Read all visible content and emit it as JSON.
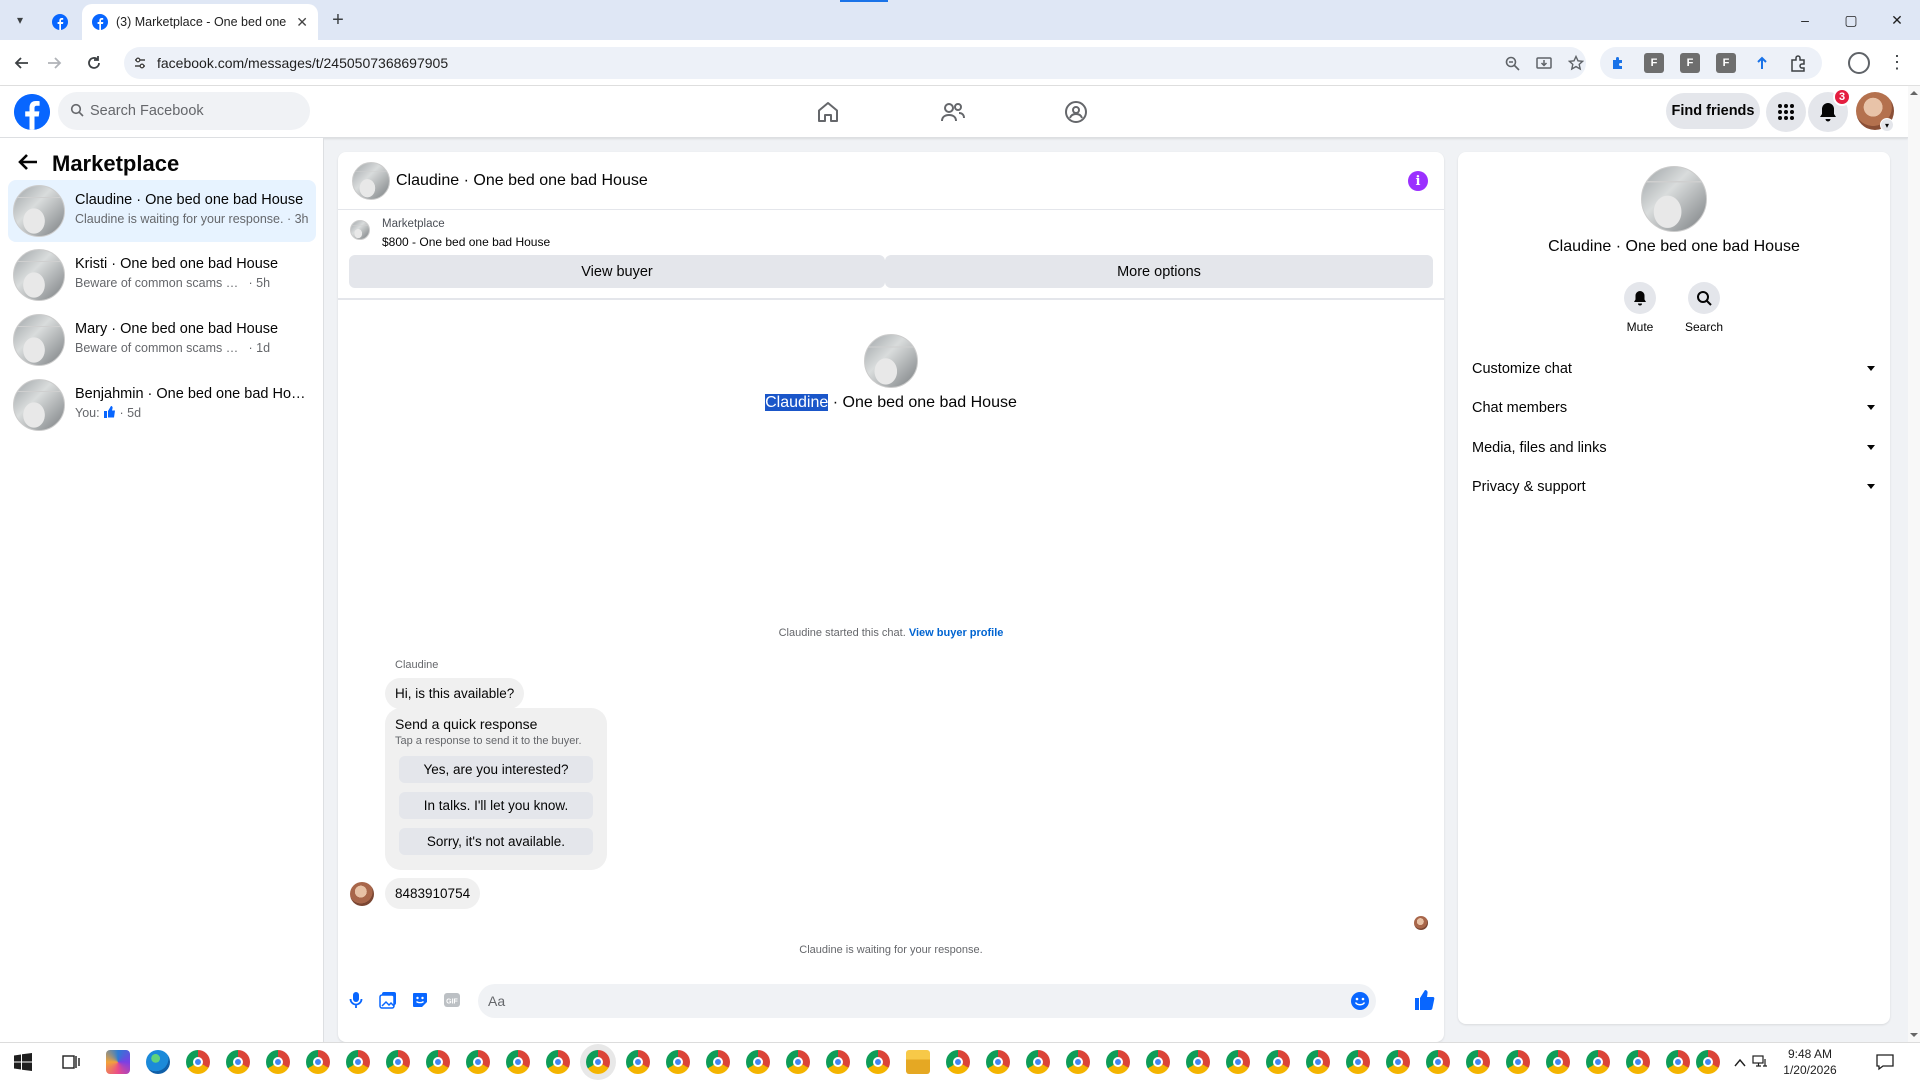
{
  "browser": {
    "tab_title": "(3) Marketplace - One bed one",
    "tab_close": "✕",
    "new_tab": "+",
    "url": "facebook.com/messages/t/2450507368697905",
    "window": {
      "minimize": "–",
      "maximize": "▢",
      "close": "✕"
    },
    "extensions": [
      "F",
      "F",
      "F"
    ]
  },
  "fb": {
    "search_placeholder": "Search Facebook",
    "find_friends": "Find friends",
    "notification_count": "3"
  },
  "left": {
    "title": "Marketplace",
    "conversations": [
      {
        "name": "Claudine · One bed one bad House",
        "preview": "Claudine is waiting for your response.",
        "time": "· 3h",
        "active": true
      },
      {
        "name": "Kristi · One bed one bad House",
        "preview": "Beware of common scams using pay...",
        "time": "· 5h"
      },
      {
        "name": "Mary · One bed one bad House",
        "preview": "Beware of common scams using pay...",
        "time": "· 1d"
      },
      {
        "name": "Benjahmin · One bed one bad Hou...",
        "preview": "You:",
        "time": "· 5d"
      }
    ]
  },
  "chat": {
    "title": "Claudine · One bed one bad House",
    "marketplace_label": "Marketplace",
    "listing": "$800 - One bed one bad House",
    "view_buyer": "View buyer",
    "more_options": "More options",
    "center_name_selected": "Claudine",
    "center_name_rest": " · One bed one bad House",
    "started_text": "Claudine started this chat.",
    "view_buyer_profile": "View buyer profile",
    "sender": "Claudine",
    "message_1": "Hi, is this available?",
    "quick_response": {
      "title": "Send a quick response",
      "subtitle": "Tap a response to send it to the buyer.",
      "options": [
        "Yes, are you interested?",
        "In talks. I'll let you know.",
        "Sorry, it's not available."
      ]
    },
    "message_2": "8483910754",
    "waiting": "Claudine is waiting for your response.",
    "composer_placeholder": "Aa"
  },
  "right": {
    "name": "Claudine · One bed one bad House",
    "mute": "Mute",
    "search": "Search",
    "sections": [
      "Customize chat",
      "Chat members",
      "Media, files and links",
      "Privacy & support"
    ]
  },
  "taskbar": {
    "time": "9:48 AM",
    "date": "1/20/2026"
  },
  "colors": {
    "fb_blue": "#0866ff",
    "active_row": "#e7f3ff",
    "info_purple": "#9b30ff",
    "notif_red": "#e41e3f"
  }
}
